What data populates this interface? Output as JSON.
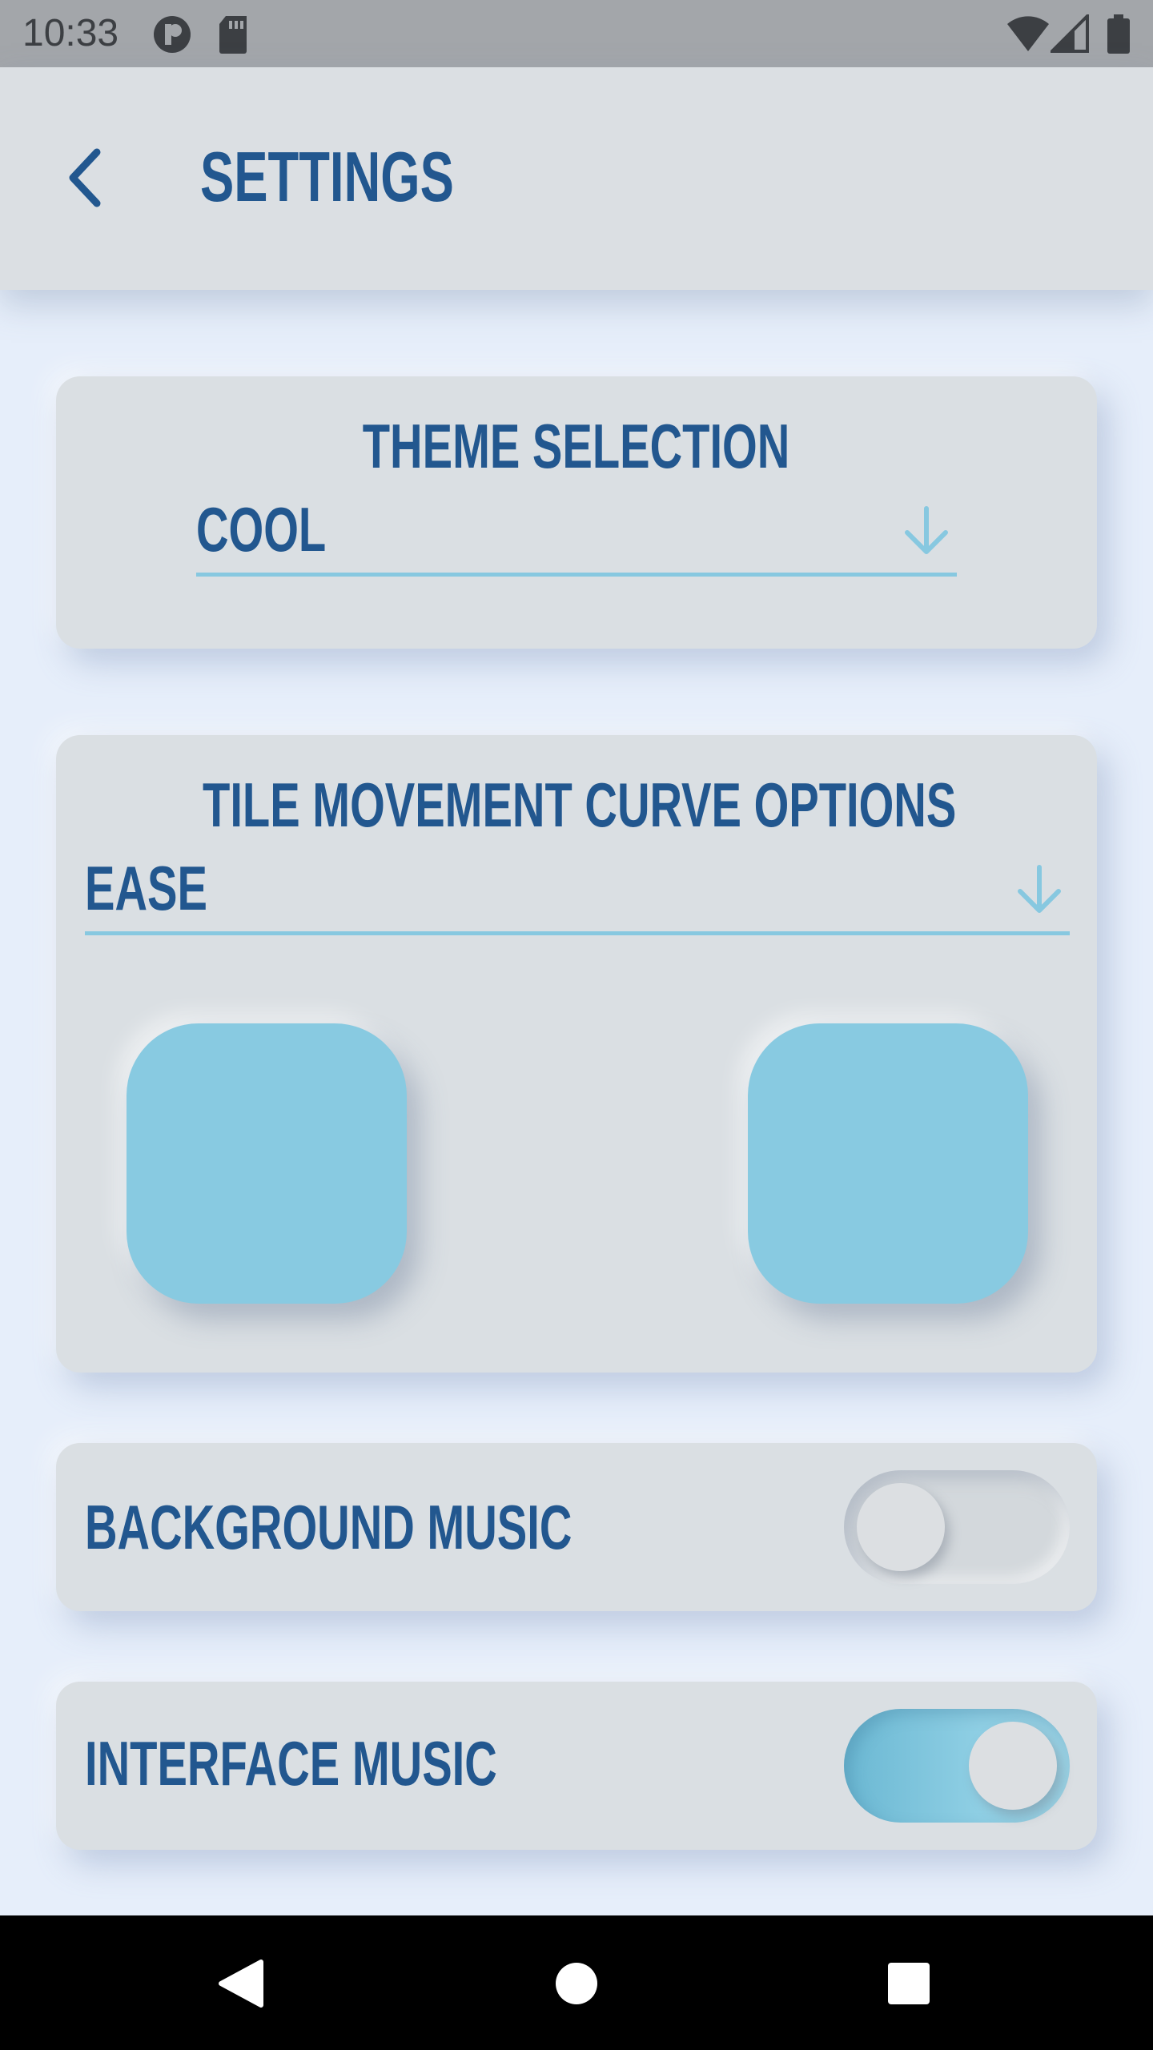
{
  "status_bar": {
    "time": "10:33",
    "icons": [
      "circle-p-icon",
      "sd-card-icon",
      "wifi-icon",
      "signal-icon",
      "battery-icon"
    ]
  },
  "app_bar": {
    "title": "SETTINGS",
    "back_icon": "chevron-left-icon"
  },
  "theme_card": {
    "title": "THEME SELECTION",
    "selected": "COOL",
    "arrow_icon": "arrow-down-icon"
  },
  "curve_card": {
    "title": "TILE MOVEMENT CURVE OPTIONS",
    "selected": "EASE",
    "arrow_icon": "arrow-down-icon"
  },
  "background_music": {
    "label": "BACKGROUND MUSIC",
    "enabled": false
  },
  "interface_music": {
    "label": "INTERFACE MUSIC",
    "enabled": true
  },
  "nav_bar": {
    "icons": [
      "back-triangle-icon",
      "home-circle-icon",
      "recents-square-icon"
    ]
  },
  "colors": {
    "accent": "#22578f",
    "tile": "#88cae1",
    "underline": "#87c8e0",
    "card": "#dadfe3",
    "background": "#e6eefa"
  }
}
